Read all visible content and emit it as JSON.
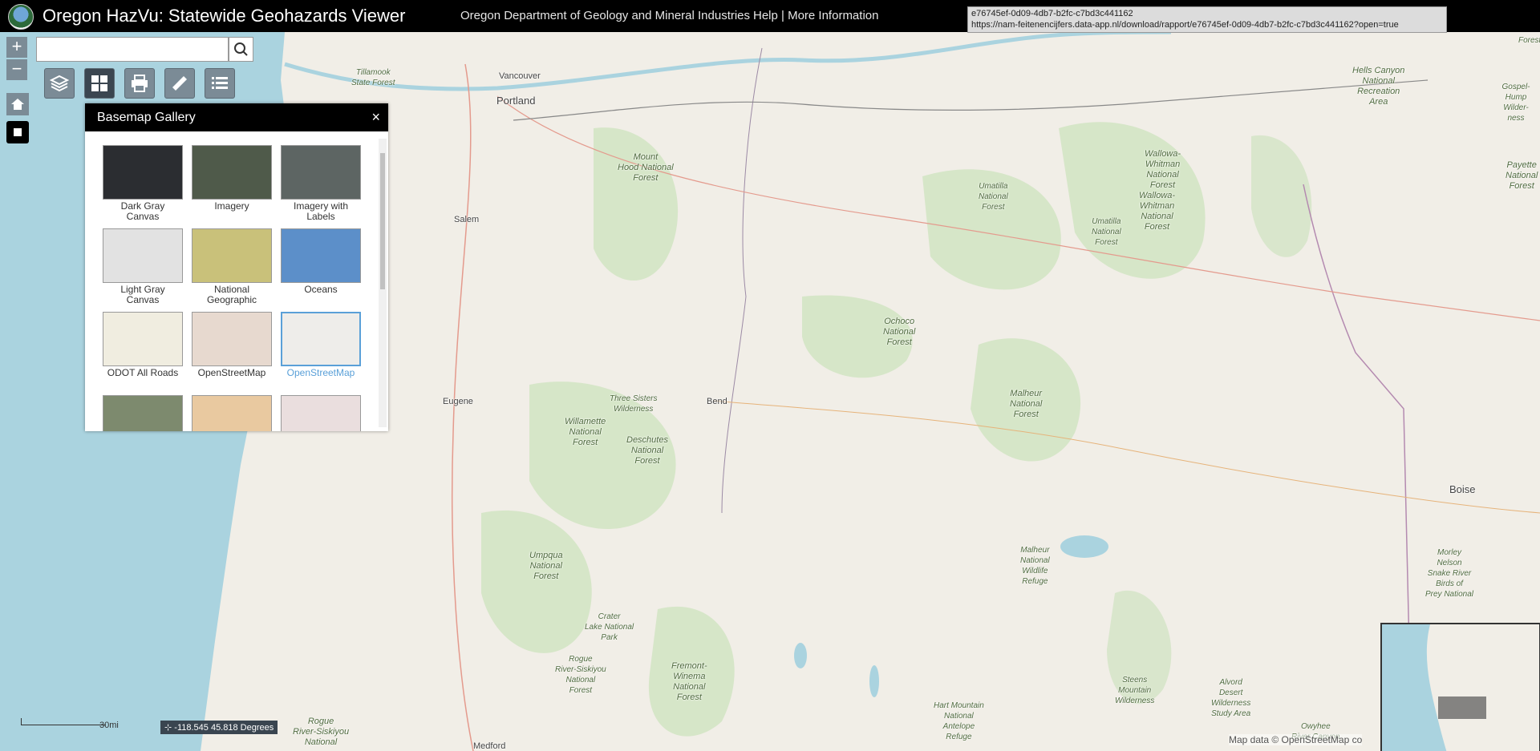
{
  "header": {
    "title": "Oregon HazVu: Statewide Geohazards Viewer",
    "org_link": "Oregon Department of Geology and Mineral Industries",
    "help_link": "Help | More Information"
  },
  "tooltip": {
    "line1": "e76745ef-0d09-4db7-b2fc-c7bd3c441162",
    "line2": "https://nam-feitenencijfers.data-app.nl/download/rapport/e76745ef-0d09-4db7-b2fc-c7bd3c441162?open=true"
  },
  "search": {
    "value": "",
    "placeholder": ""
  },
  "zoom": {
    "in": "+",
    "out": "−"
  },
  "basemap_gallery": {
    "title": "Basemap Gallery",
    "close": "×",
    "tiles": [
      {
        "label": "Dark Gray\nCanvas",
        "color": "#2b2d31"
      },
      {
        "label": "Imagery",
        "color": "#4f5a4a"
      },
      {
        "label": "Imagery with\nLabels",
        "color": "#5d6563"
      },
      {
        "label": "Light Gray\nCanvas",
        "color": "#e2e2e2"
      },
      {
        "label": "National\nGeographic",
        "color": "#c9c17a"
      },
      {
        "label": "Oceans",
        "color": "#5c8fc9"
      },
      {
        "label": "ODOT All Roads",
        "color": "#f0ede0"
      },
      {
        "label": "OpenStreetMap",
        "color": "#e7d9cf"
      },
      {
        "label": "OpenStreetMap",
        "color": "#eeedea",
        "selected": true
      },
      {
        "label": "",
        "color": "#7d8a6e"
      },
      {
        "label": "",
        "color": "#e9c9a0"
      },
      {
        "label": "",
        "color": "#eadede"
      }
    ]
  },
  "map": {
    "cities": [
      {
        "name": "Vancouver"
      },
      {
        "name": "Portland"
      },
      {
        "name": "Salem"
      },
      {
        "name": "Eugene"
      },
      {
        "name": "Bend"
      },
      {
        "name": "Boise"
      },
      {
        "name": "Medford"
      }
    ],
    "forests": [
      "Tillamook\nState Forest",
      "Mount\nHood National\nForest",
      "Umatilla\nNational\nForest",
      "Wallowa-\nWhitman\nNational\nForest",
      "Umatilla\nNational\nForest",
      "Wallowa-\nWhitman\nNational\nForest",
      "Hells Canyon\nNational\nRecreation\nArea",
      "Payette\nNational\nForest",
      "Ochoco\nNational\nForest",
      "Three Sisters\nWilderness",
      "Willamette\nNational\nForest",
      "Deschutes\nNational\nForest",
      "Malheur\nNational\nForest",
      "Umpqua\nNational\nForest",
      "Crater\nLake National\nPark",
      "Rogue\nRiver-Siskiyou\nNational\nForest",
      "Fremont-\nWinema\nNational\nForest",
      "Malheur\nNational\nWildlife\nRefuge",
      "Hart Mountain\nNational\nAntelope\nRefuge",
      "Steens\nMountain\nWilderness",
      "Alvord\nDesert\nWilderness\nStudy Area",
      "Morley\nNelson\nSnake River\nBirds of\nPrey National",
      "Rogue\nRiver-Siskiyou\nNational",
      "Owyhee\nRiver Canyon",
      "Gospel-\nHump Wilder-\nness",
      "Forest"
    ],
    "other_labels": [
      "Boise"
    ]
  },
  "scale": {
    "label": "30mi"
  },
  "coords": {
    "text": "-118.545 45.818 Degrees"
  },
  "attribution": "Map data © OpenStreetMap co"
}
